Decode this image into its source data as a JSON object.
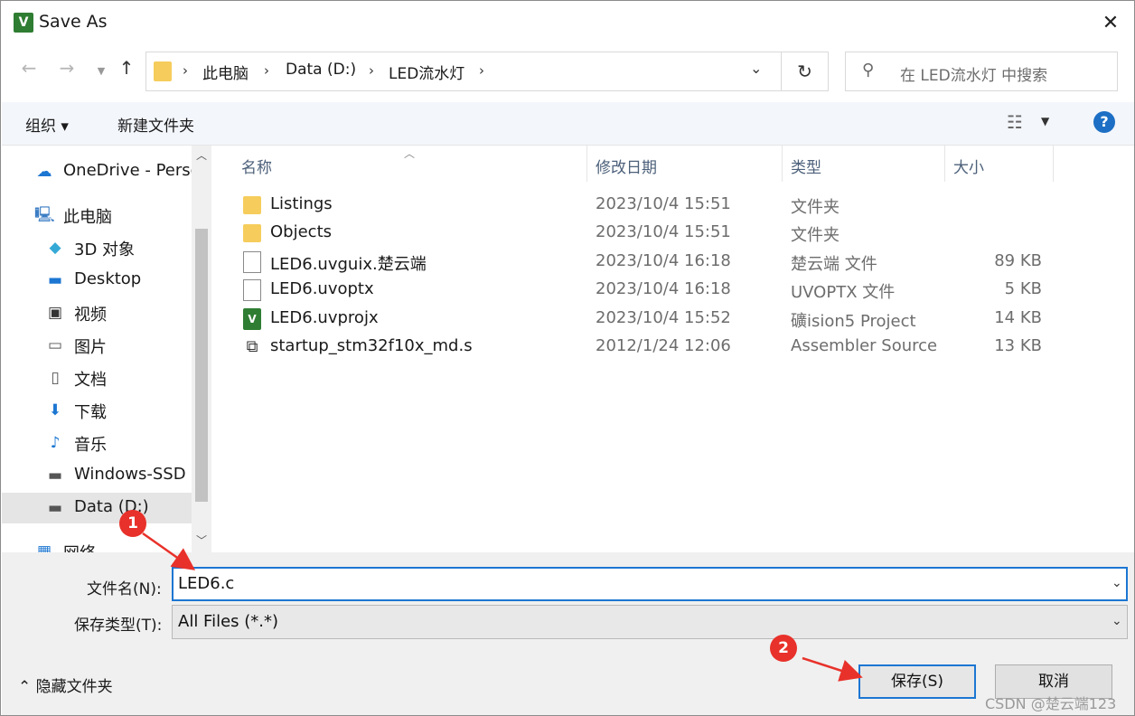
{
  "window": {
    "title": "Save As",
    "app_icon_text": "V"
  },
  "nav": {
    "back_icon": "arrow-left-icon",
    "forward_icon": "arrow-right-icon",
    "up_icon": "arrow-up-icon",
    "breadcrumbs": [
      "此电脑",
      "Data (D:)",
      "LED流水灯"
    ],
    "search_placeholder": "在 LED流水灯 中搜索"
  },
  "toolbar": {
    "organize_label": "组织 ▾",
    "new_folder_label": "新建文件夹"
  },
  "sidebar": {
    "items": [
      {
        "label": "OneDrive - Perso",
        "icon": "cloud-icon"
      },
      {
        "label": "此电脑",
        "icon": "computer-icon"
      },
      {
        "label": "3D 对象",
        "icon": "cube-icon"
      },
      {
        "label": "Desktop",
        "icon": "desktop-icon"
      },
      {
        "label": "视频",
        "icon": "video-icon"
      },
      {
        "label": "图片",
        "icon": "picture-icon"
      },
      {
        "label": "文档",
        "icon": "document-icon"
      },
      {
        "label": "下载",
        "icon": "download-icon"
      },
      {
        "label": "音乐",
        "icon": "music-icon"
      },
      {
        "label": "Windows-SSD",
        "icon": "drive-icon"
      },
      {
        "label": "Data (D:)",
        "icon": "drive-icon"
      },
      {
        "label": "网络",
        "icon": "network-icon"
      }
    ]
  },
  "files": {
    "columns": [
      "名称",
      "修改日期",
      "类型",
      "大小"
    ],
    "rows": [
      {
        "name": "Listings",
        "date": "2023/10/4 15:51",
        "type": "文件夹",
        "size": "",
        "icon": "folder-icon"
      },
      {
        "name": "Objects",
        "date": "2023/10/4 15:51",
        "type": "文件夹",
        "size": "",
        "icon": "folder-icon"
      },
      {
        "name": "LED6.uvguix.楚云端",
        "date": "2023/10/4 16:18",
        "type": "楚云端 文件",
        "size": "89 KB",
        "icon": "file-icon"
      },
      {
        "name": "LED6.uvoptx",
        "date": "2023/10/4 16:18",
        "type": "UVOPTX 文件",
        "size": "5 KB",
        "icon": "file-icon"
      },
      {
        "name": "LED6.uvprojx",
        "date": "2023/10/4 15:52",
        "type": "礦ision5 Project",
        "size": "14 KB",
        "icon": "uvision-icon"
      },
      {
        "name": "startup_stm32f10x_md.s",
        "date": "2012/1/24 12:06",
        "type": "Assembler Source",
        "size": "13 KB",
        "icon": "assembler-icon"
      }
    ]
  },
  "form": {
    "filename_label": "文件名(N):",
    "filename_value": "LED6.c",
    "filetype_label": "保存类型(T):",
    "filetype_value": "All Files (*.*)",
    "hide_folders_label": "隐藏文件夹",
    "save_label": "保存(S)",
    "cancel_label": "取消"
  },
  "annotations": {
    "badge_1": "1",
    "badge_2": "2",
    "color": "#e8312a"
  },
  "watermark": "CSDN @楚云端123"
}
